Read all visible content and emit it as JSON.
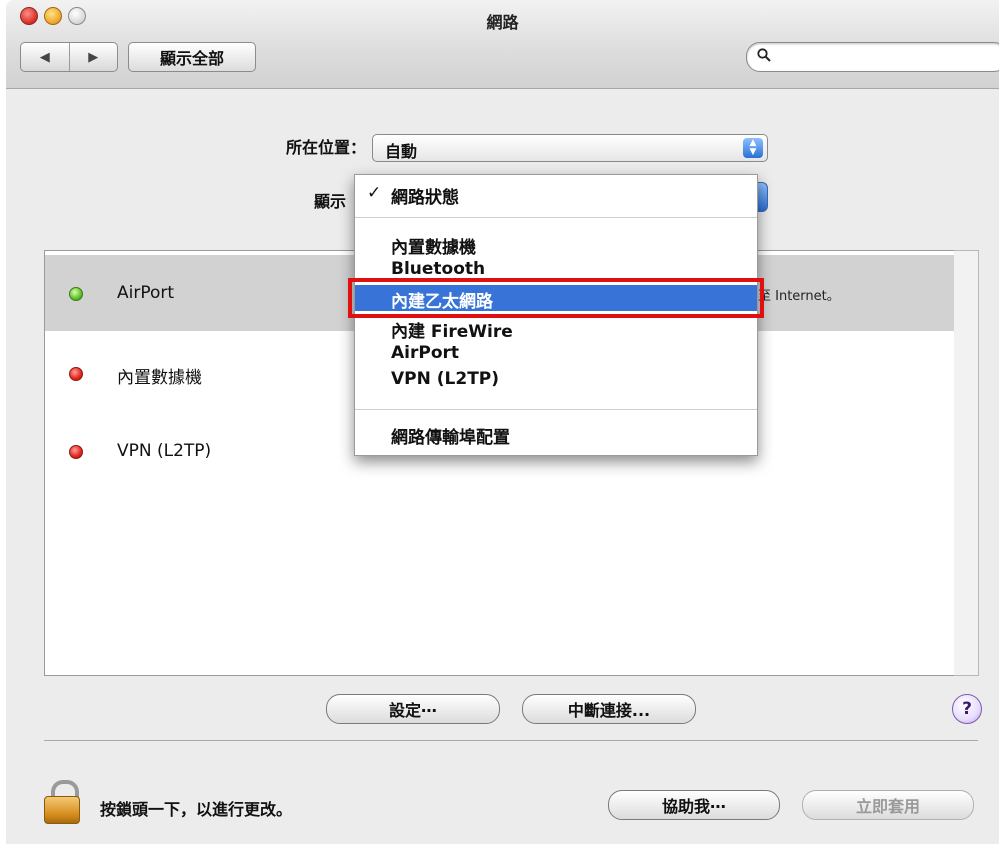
{
  "window": {
    "title": "網路",
    "nav_back": "◀",
    "nav_forward": "▶",
    "show_all": "顯示全部",
    "search_icon": "search-icon"
  },
  "location": {
    "label": "所在位置：",
    "value": "自動"
  },
  "show": {
    "label": "顯示"
  },
  "menu": {
    "items": [
      {
        "label": "網路狀態",
        "checked": true
      },
      {
        "label": "內置數據機"
      },
      {
        "label": "Bluetooth"
      },
      {
        "label": "內建乙太網路",
        "highlighted": true
      },
      {
        "label": "內建 FireWire"
      },
      {
        "label": "AirPort"
      },
      {
        "label": "VPN (L2TP)"
      },
      {
        "label": "網路傳輸埠配置"
      }
    ]
  },
  "services": [
    {
      "name": "AirPort",
      "status": "接至 Internet。",
      "color": "#5fc02a"
    },
    {
      "name": "內置數據機",
      "status": "",
      "color": "#e0251c"
    },
    {
      "name": "VPN (L2TP)",
      "status": "",
      "color": "#e0251c"
    }
  ],
  "buttons": {
    "configure": "設定⋯",
    "disconnect": "中斷連接...",
    "help": "?",
    "assist": "協助我⋯",
    "apply": "立即套用"
  },
  "lock": {
    "text": "按鎖頭一下，以進行更改。"
  },
  "colors": {
    "highlight": "#3874d8",
    "callout": "#e01010"
  }
}
